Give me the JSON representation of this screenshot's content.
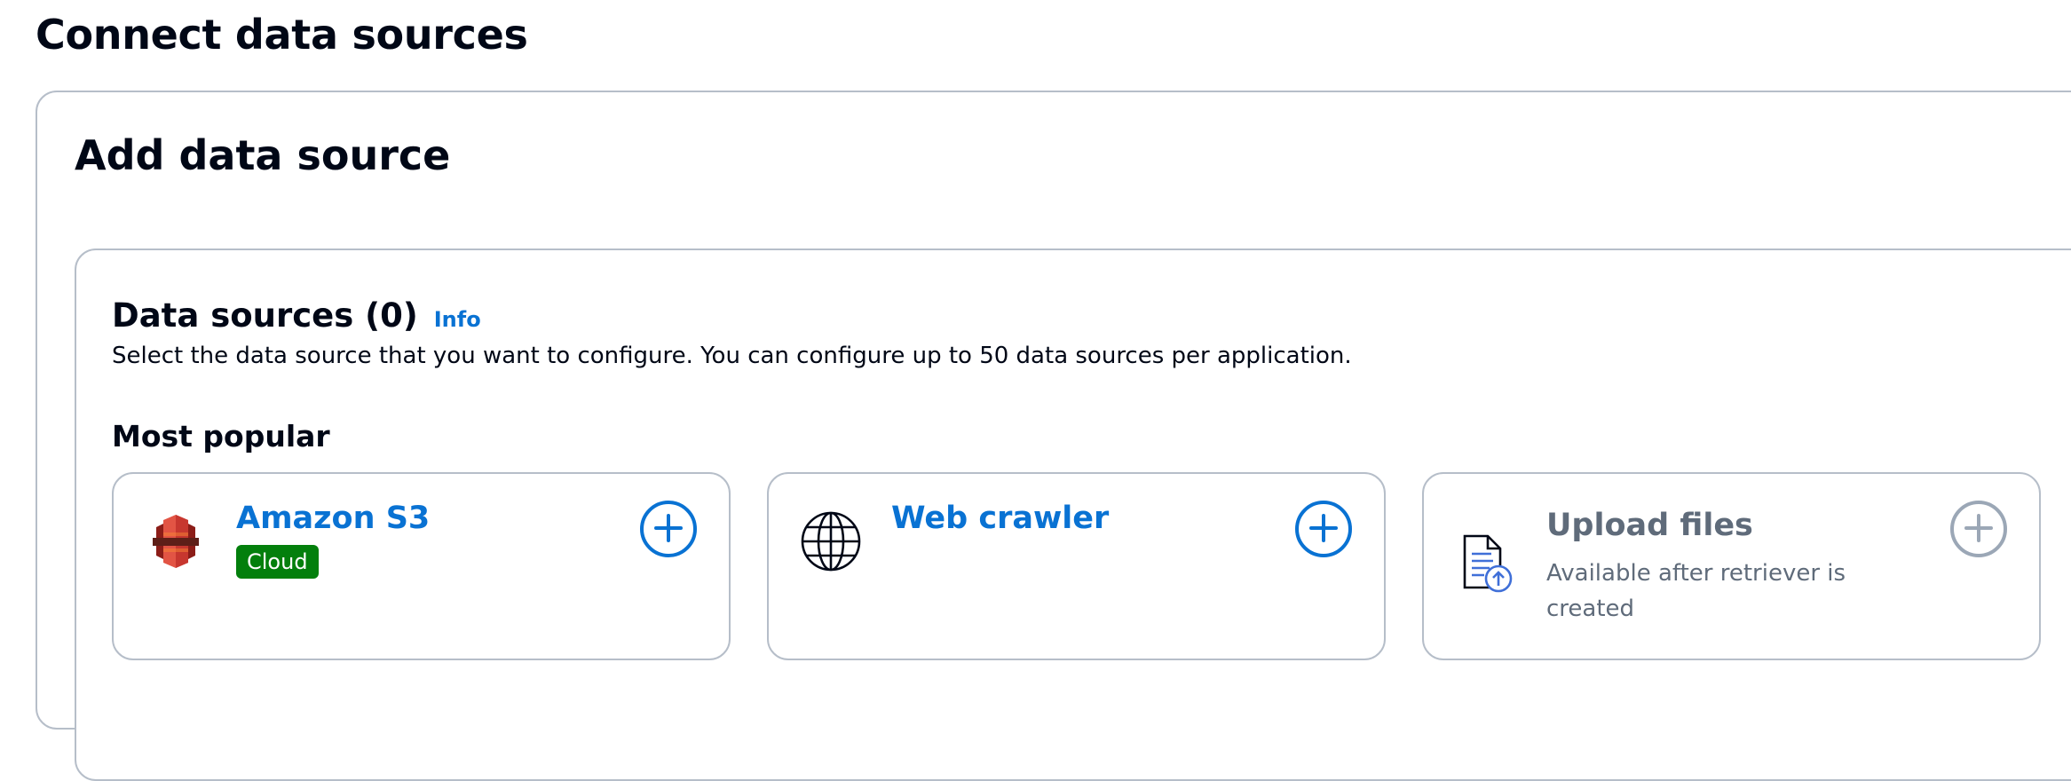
{
  "page": {
    "title": "Connect data sources"
  },
  "panel": {
    "title": "Add data source"
  },
  "data_sources": {
    "title": "Data sources (0)",
    "info_label": "Info",
    "description": "Select the data source that you want to configure. You can configure up to 50 data sources per application.",
    "popular_heading": "Most popular",
    "cards": [
      {
        "title": "Amazon S3",
        "badge": "Cloud",
        "icon": "amazon-s3-icon",
        "enabled": true
      },
      {
        "title": "Web crawler",
        "icon": "globe-icon",
        "enabled": true
      },
      {
        "title": "Upload files",
        "subtitle": "Available after retriever is created",
        "icon": "upload-file-icon",
        "enabled": false
      }
    ]
  },
  "colors": {
    "link": "#0972d3",
    "badge_green": "#037f0c",
    "disabled_text": "#5f6b7a",
    "border": "#b6bec9"
  }
}
